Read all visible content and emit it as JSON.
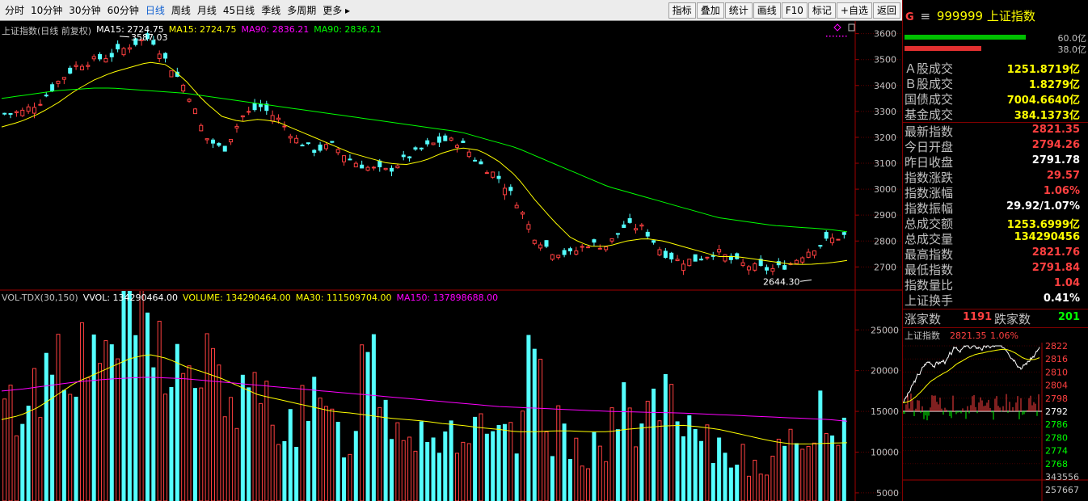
{
  "toolbar": {
    "periods": [
      "分时",
      "10分钟",
      "30分钟",
      "60分钟",
      "日线",
      "周线",
      "月线",
      "45日线",
      "季线",
      "多周期",
      "更多 ▸"
    ],
    "active_period_index": 4,
    "buttons": [
      "指标",
      "叠加",
      "统计",
      "画线",
      "F10",
      "标记",
      "+自选",
      "返回"
    ]
  },
  "main_legend": {
    "title": "上证指数(日线 前复权)",
    "items": [
      {
        "text": "MA15: 2724.75",
        "color": "#ffffff"
      },
      {
        "text": "MA15: 2724.75",
        "color": "#ffff00"
      },
      {
        "text": "MA90: 2836.21",
        "color": "#ff00ff"
      },
      {
        "text": "MA90: 2836.21",
        "color": "#00ff00"
      }
    ]
  },
  "vol_legend": {
    "items": [
      {
        "text": "VOL-TDX(30,150)",
        "color": "#c0c0c0"
      },
      {
        "text": "VVOL: 134290464.00",
        "color": "#ffffff"
      },
      {
        "text": "VOLUME: 134290464.00",
        "color": "#ffff00"
      },
      {
        "text": "MA30: 111509704.00",
        "color": "#ffff00"
      },
      {
        "text": "MA150: 137898688.00",
        "color": "#ff00ff"
      }
    ]
  },
  "chart_data": [
    {
      "type": "candlestick",
      "title": "上证指数(日线 前复权)",
      "y_axis_ticks": [
        "3600",
        "3500",
        "3400",
        "3300",
        "3200",
        "3100",
        "3000",
        "2900",
        "2800",
        "2700"
      ],
      "ylim": [
        2620,
        3630
      ],
      "annotations": [
        {
          "text": "3587.03"
        },
        {
          "text": "2644.30"
        }
      ],
      "series": [
        {
          "name": "MA15",
          "color": "#ffff00"
        },
        {
          "name": "MA90",
          "color": "#00ff00"
        }
      ],
      "close_trend": [
        3290,
        3300,
        3340,
        3420,
        3480,
        3500,
        3520,
        3560,
        3587,
        3480,
        3380,
        3200,
        3150,
        3280,
        3320,
        3270,
        3190,
        3150,
        3170,
        3110,
        3080,
        3070,
        3120,
        3160,
        3190,
        3180,
        3100,
        3050,
        2960,
        2820,
        2760,
        2750,
        2790,
        2780,
        2860,
        2850,
        2760,
        2720,
        2730,
        2760,
        2720,
        2700,
        2690,
        2710,
        2760,
        2800,
        2821
      ],
      "ma15_trend": [
        3240,
        3260,
        3290,
        3330,
        3380,
        3420,
        3450,
        3470,
        3490,
        3480,
        3420,
        3340,
        3280,
        3260,
        3270,
        3260,
        3230,
        3200,
        3170,
        3140,
        3120,
        3100,
        3095,
        3110,
        3140,
        3160,
        3150,
        3110,
        3050,
        2960,
        2880,
        2810,
        2780,
        2780,
        2800,
        2810,
        2800,
        2780,
        2760,
        2740,
        2740,
        2730,
        2720,
        2710,
        2710,
        2715,
        2725
      ],
      "ma90_trend": [
        3350,
        3360,
        3370,
        3380,
        3385,
        3390,
        3390,
        3385,
        3380,
        3375,
        3370,
        3360,
        3350,
        3340,
        3330,
        3320,
        3310,
        3300,
        3290,
        3280,
        3270,
        3260,
        3250,
        3240,
        3230,
        3220,
        3200,
        3180,
        3160,
        3130,
        3100,
        3070,
        3040,
        3010,
        2990,
        2970,
        2950,
        2930,
        2910,
        2890,
        2880,
        2870,
        2860,
        2855,
        2850,
        2845,
        2836
      ]
    },
    {
      "type": "bar",
      "title": "VOL-TDX(30,150)",
      "y_axis_ticks": [
        "25000",
        "20000",
        "15000",
        "10000",
        "5000"
      ],
      "ylim": [
        4000,
        28000
      ],
      "volume_trend": [
        15000,
        16000,
        19000,
        24000,
        22000,
        20000,
        26000,
        28000,
        25000,
        22000,
        19000,
        21000,
        18000,
        16000,
        17000,
        15000,
        14000,
        16000,
        13000,
        12000,
        27000,
        15000,
        14000,
        13000,
        12500,
        13000,
        12000,
        11500,
        11000,
        23000,
        13000,
        12000,
        11000,
        11000,
        16000,
        14000,
        17000,
        13000,
        11000,
        10500,
        10000,
        9800,
        9500,
        10000,
        14000,
        15000,
        13400
      ],
      "ma30_trend": [
        14000,
        14500,
        15500,
        17000,
        18500,
        19500,
        20500,
        21500,
        22000,
        21500,
        20500,
        19800,
        19000,
        18000,
        17000,
        16500,
        16000,
        15500,
        15000,
        14800,
        14500,
        14200,
        14000,
        13800,
        13500,
        13300,
        13000,
        12800,
        12500,
        12500,
        12600,
        12600,
        12500,
        12500,
        12800,
        13000,
        13200,
        13300,
        13100,
        12800,
        12300,
        11800,
        11300,
        11000,
        11000,
        11100,
        11150
      ],
      "ma150_trend": [
        17500,
        17700,
        18000,
        18300,
        18600,
        18800,
        19000,
        19100,
        19200,
        19100,
        19000,
        18800,
        18600,
        18400,
        18200,
        18000,
        17800,
        17600,
        17400,
        17200,
        17000,
        16800,
        16600,
        16400,
        16200,
        16000,
        15800,
        15600,
        15500,
        15400,
        15300,
        15200,
        15100,
        15000,
        14950,
        14900,
        14850,
        14800,
        14700,
        14600,
        14500,
        14400,
        14300,
        14200,
        14100,
        14000,
        13790
      ]
    }
  ],
  "quote": {
    "badge": "G",
    "menu_glyph": "≡",
    "code": "999999",
    "name": "上证指数",
    "bars": [
      {
        "fill": 0.6,
        "value": "60.0亿",
        "color": "#00c000"
      },
      {
        "fill": 0.38,
        "value": "38.0亿",
        "color": "#e03030"
      }
    ],
    "rows_a": [
      {
        "label": "Ａ股成交",
        "value": "1251.8719亿",
        "color": "#ffff00"
      },
      {
        "label": "Ｂ股成交",
        "value": "1.8279亿",
        "color": "#ffff00"
      },
      {
        "label": "国债成交",
        "value": "7004.6640亿",
        "color": "#ffff00"
      },
      {
        "label": "基金成交",
        "value": "384.1373亿",
        "color": "#ffff00"
      }
    ],
    "rows_b": [
      {
        "label": "最新指数",
        "value": "2821.35",
        "color": "#ff4040"
      },
      {
        "label": "今日开盘",
        "value": "2794.26",
        "color": "#ff4040"
      },
      {
        "label": "昨日收盘",
        "value": "2791.78",
        "color": "#ffffff"
      },
      {
        "label": "指数涨跌",
        "value": "29.57",
        "color": "#ff4040"
      },
      {
        "label": "指数涨幅",
        "value": "1.06%",
        "color": "#ff4040"
      },
      {
        "label": "指数振幅",
        "value": "29.92/1.07%",
        "color": "#ffffff"
      },
      {
        "label": "总成交额",
        "value": "1253.6999亿",
        "color": "#ffff00"
      },
      {
        "label": "总成交量",
        "value": "134290456",
        "color": "#ffff00"
      },
      {
        "label": "最高指数",
        "value": "2821.76",
        "color": "#ff4040"
      },
      {
        "label": "最低指数",
        "value": "2791.84",
        "color": "#ff4040"
      },
      {
        "label": "指数量比",
        "value": "1.04",
        "color": "#ff4040"
      },
      {
        "label": "上证换手",
        "value": "0.41%",
        "color": "#ffffff"
      }
    ],
    "updown": {
      "up_label": "涨家数",
      "up_value": "1191",
      "down_label": "跌家数",
      "down_value": "201"
    },
    "mini": {
      "title": "上证指数",
      "last": "2821.35",
      "pct": "1.06%",
      "price_ticks": [
        "2822",
        "2816",
        "2810",
        "2804",
        "2798",
        "2792",
        "2786",
        "2780",
        "2774",
        "2768",
        "343556",
        "257667"
      ],
      "ref_price": "2792"
    }
  }
}
